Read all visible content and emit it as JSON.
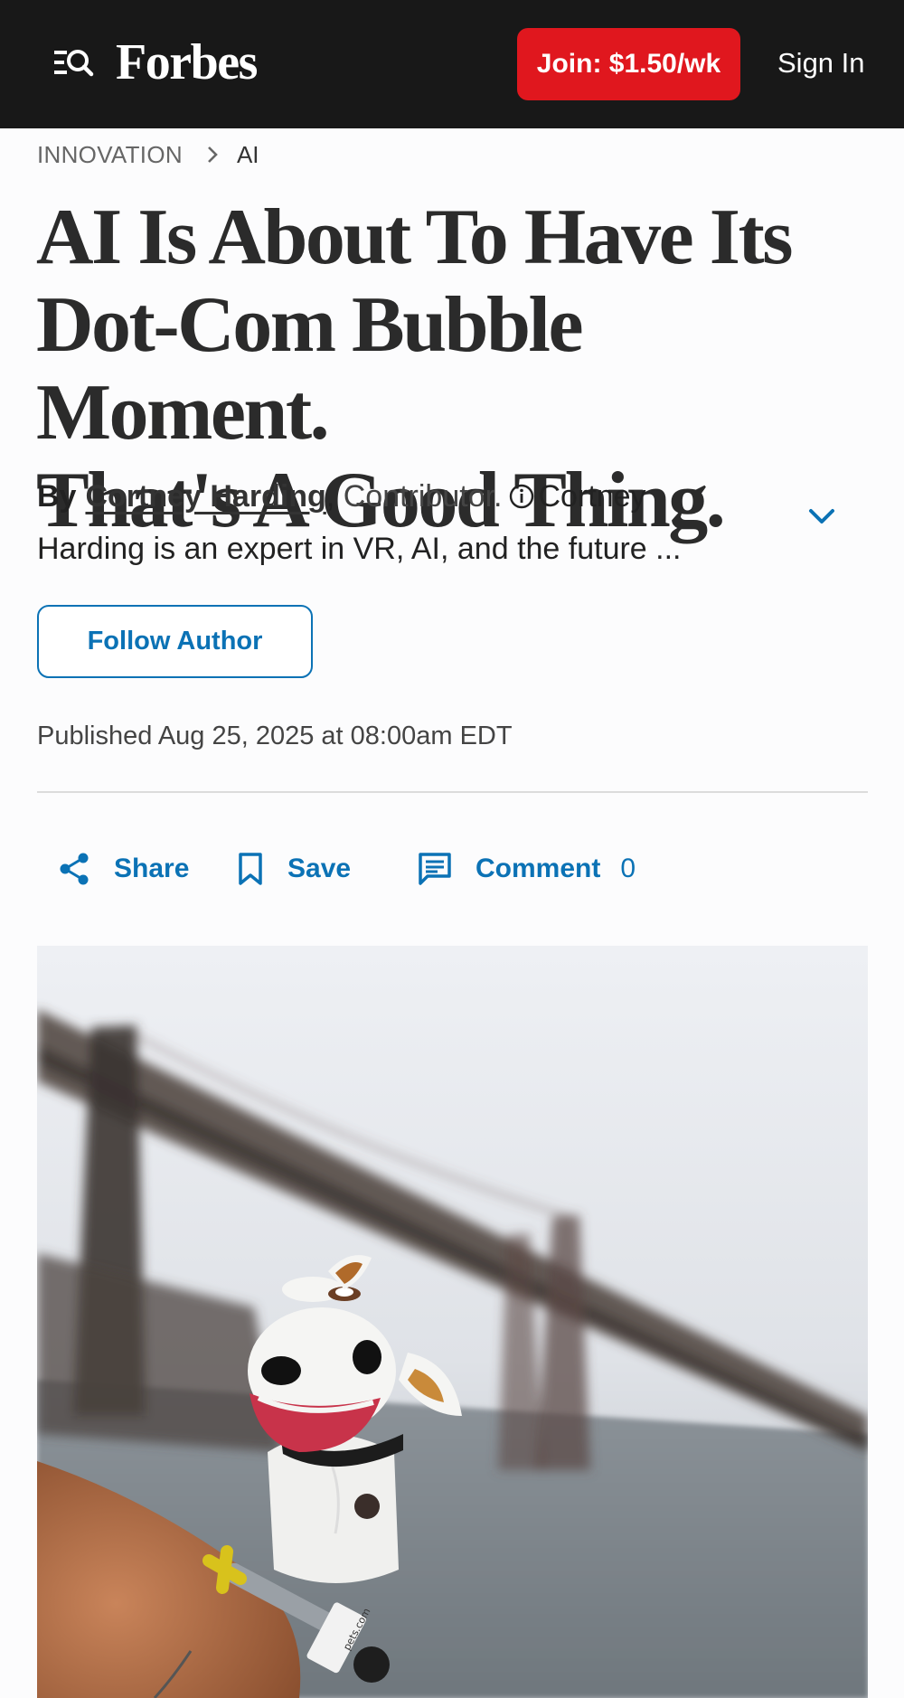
{
  "header": {
    "logo_text": "Forbes",
    "menu_icon": "menu-search-icon",
    "join_label": "Join: $1.50/wk",
    "signin_label": "Sign In",
    "bg_color": "#181818",
    "join_color": "#e0171e"
  },
  "breadcrumb": {
    "section": "INNOVATION",
    "separator_icon": "chevron-right-icon",
    "subsection": "AI"
  },
  "article": {
    "headline_lines": [
      "AI Is About To Have Its",
      "Dot-Com Bubble Moment.",
      "That's A Good Thing."
    ],
    "byline": {
      "by": "By",
      "author": "Cortney Harding",
      "comma": ",",
      "role": "Contributor.",
      "info_icon": "info-icon",
      "bio_line1": "Cortney",
      "bio_line2": "Harding is an expert in VR, AI, and the future ...",
      "expand_icon": "chevron-down-icon"
    },
    "follow_label": "Follow Author",
    "published": "Published Aug 25, 2025 at 08:00am EDT"
  },
  "actions": {
    "share_label": "Share",
    "save_label": "Save",
    "comment_label": "Comment",
    "comment_count": "0",
    "accent_color": "#0b72b5"
  },
  "hero_image": {
    "subject": "sock puppet dog holding microphone in front of Golden Gate Bridge",
    "mic_flag_text": "pets.com"
  }
}
